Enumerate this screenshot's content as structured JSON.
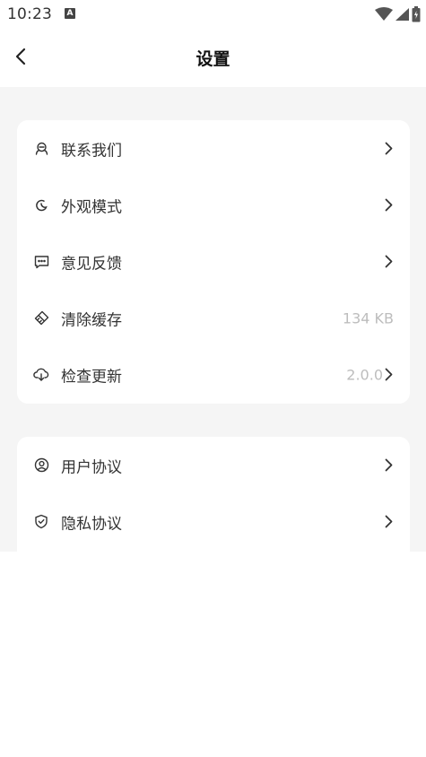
{
  "status_bar": {
    "time": "10:23",
    "notification_icon_letter": "A"
  },
  "header": {
    "title": "设置",
    "back_icon": "chevron-left-icon"
  },
  "settings_group_1": [
    {
      "label": "联系我们",
      "icon": "headset-icon",
      "value": "",
      "chevron": true
    },
    {
      "label": "外观模式",
      "icon": "moon-icon",
      "value": "",
      "chevron": true
    },
    {
      "label": "意见反馈",
      "icon": "message-icon",
      "value": "",
      "chevron": true
    },
    {
      "label": "清除缓存",
      "icon": "eraser-icon",
      "value": "134 KB",
      "chevron": false
    },
    {
      "label": "检查更新",
      "icon": "cloud-download-icon",
      "value": "2.0.0",
      "chevron": true
    }
  ],
  "settings_group_2": [
    {
      "label": "用户协议",
      "icon": "user-circle-icon",
      "value": "",
      "chevron": true
    },
    {
      "label": "隐私协议",
      "icon": "shield-check-icon",
      "value": "",
      "chevron": true
    }
  ],
  "colors": {
    "page_background": "#f5f5f5",
    "card_background": "#ffffff",
    "text_primary": "#333333",
    "text_secondary": "#bdbdbd"
  }
}
